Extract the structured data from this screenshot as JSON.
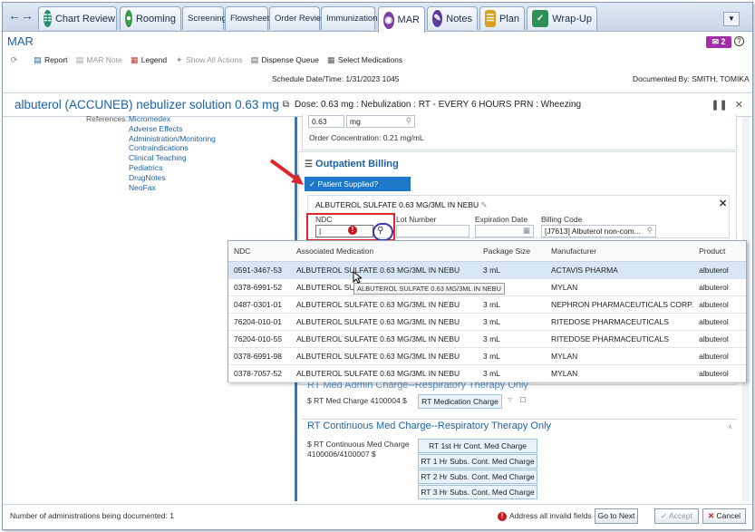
{
  "tabs": [
    {
      "label": "Chart Review",
      "icon": "chart-review-icon"
    },
    {
      "label": "Rooming",
      "icon": "rooming-icon"
    },
    {
      "label": "Screenings"
    },
    {
      "label": "Flowsheets"
    },
    {
      "label": "Order Review"
    },
    {
      "label": "Immunizations"
    },
    {
      "label": "MAR",
      "icon": "mar-icon"
    },
    {
      "label": "Notes",
      "icon": "notes-icon"
    },
    {
      "label": "Plan",
      "icon": "plan-icon"
    },
    {
      "label": "Wrap-Up",
      "icon": "wrap-up-icon"
    }
  ],
  "page_title": "MAR",
  "badge_count": "2",
  "toolbar": {
    "report": "Report",
    "mar_note": "MAR Note",
    "legend": "Legend",
    "show_all_actions": "Show All Actions",
    "dispense_queue": "Dispense Queue",
    "select_medications": "Select Medications"
  },
  "schedule": "Schedule Date/Time: 1/31/2023 1045",
  "documented_by": "Documented By: SMITH, TOMIKA",
  "medication": {
    "name": "albuterol (ACCUNEB) nebulizer solution 0.63 mg",
    "dose_prefix": "Dose:",
    "dose_detail": "0.63 mg : Nebulization : RT - EVERY 6 HOURS PRN : Wheezing"
  },
  "references": {
    "label": "References:",
    "items": [
      "Micromedex",
      "Adverse Effects",
      "Administration/Monitoring",
      "Contraindications",
      "Clinical Teaching",
      "Pediatrics",
      "DrugNotes",
      "NeoFax"
    ]
  },
  "dose_entry": {
    "value": "0.63",
    "unit": "mg",
    "order_concentration_label": "Order Concentration:",
    "order_concentration_value": "0.21 mg/mL"
  },
  "outpatient_billing": {
    "title": "Outpatient Billing",
    "patient_supplied": "Patient Supplied?",
    "card_title": "ALBUTEROL SULFATE 0.63 MG/3ML IN NEBU",
    "ndc_label": "NDC",
    "ndc_value": "|",
    "lot_label": "Lot Number",
    "expiration_label": "Expiration Date",
    "billing_code_label": "Billing Code",
    "billing_code_value": "[J7613] Albuterol non-com..."
  },
  "ndc_table": {
    "columns": [
      "NDC",
      "Associated Medication",
      "Package Size",
      "Manufacturer",
      "Product"
    ],
    "rows": [
      [
        "0591-3467-53",
        "ALBUTEROL SULFATE 0.63 MG/3ML IN NEBU",
        "3 mL",
        "ACTAVIS PHARMA",
        "albuterol"
      ],
      [
        "0378-6991-52",
        "ALBUTEROL SU",
        "3 mL",
        "MYLAN",
        "albuterol"
      ],
      [
        "0487-0301-01",
        "ALBUTEROL SULFATE 0.63 MG/3ML IN NEBU",
        "3 mL",
        "NEPHRON PHARMACEUTICALS CORP.",
        "albuterol"
      ],
      [
        "76204-010-01",
        "ALBUTEROL SULFATE 0.63 MG/3ML IN NEBU",
        "3 mL",
        "RITEDOSE PHARMACEUTICALS",
        "albuterol"
      ],
      [
        "76204-010-55",
        "ALBUTEROL SULFATE 0.63 MG/3ML IN NEBU",
        "3 mL",
        "RITEDOSE PHARMACEUTICALS",
        "albuterol"
      ],
      [
        "0378-6991-98",
        "ALBUTEROL SULFATE 0.63 MG/3ML IN NEBU",
        "3 mL",
        "MYLAN",
        "albuterol"
      ],
      [
        "0378-7057-52",
        "ALBUTEROL SULFATE 0.63 MG/3ML IN NEBU",
        "3 mL",
        "MYLAN",
        "albuterol"
      ]
    ],
    "tooltip": "ALBUTEROL SULFATE 0.63 MG/3ML IN NEBU"
  },
  "rt_med_admin": {
    "title": "RT Med Admin Charge--Respiratory Therapy Only",
    "charge_label": "$ RT Med Charge 4100004 $",
    "button": "RT Medication Charge"
  },
  "rt_continuous": {
    "title": "RT Continuous Med Charge--Respiratory Therapy Only",
    "charge_label": "$ RT Continuous Med Charge 4100006/4100007 $",
    "buttons": [
      "RT 1st Hr Cont. Med Charge",
      "RT 1 Hr Subs. Cont. Med Charge",
      "RT 2 Hr Subs. Cont. Med Charge",
      "RT 3 Hr Subs. Cont. Med Charge"
    ]
  },
  "footer": {
    "admin_count": "Number of administrations being documented: 1",
    "invalid_msg": "Address all invalid fields",
    "go_to_next": "Go to Next",
    "accept": "Accept",
    "cancel": "Cancel"
  }
}
